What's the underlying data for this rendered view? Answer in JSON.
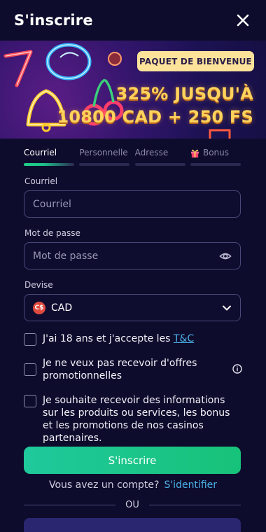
{
  "header": {
    "title": "S'inscrire",
    "close_icon": "close-icon"
  },
  "banner": {
    "badge": "PAQUET DE BIENVENUE",
    "line1": "325% JUSQU'À",
    "line2": "10800 CAD + 250 FS",
    "accent": "#ffd35c"
  },
  "steps": [
    {
      "label": "Courriel",
      "active": true
    },
    {
      "label": "Personnelle",
      "active": false
    },
    {
      "label": "Adresse",
      "active": false
    },
    {
      "label": "Bonus",
      "active": false,
      "icon": "gift-icon"
    }
  ],
  "form": {
    "email": {
      "label": "Courriel",
      "placeholder": "Courriel",
      "value": ""
    },
    "password": {
      "label": "Mot de passe",
      "placeholder": "Mot de passe",
      "value": "",
      "icon": "eye-icon"
    },
    "currency": {
      "label": "Devise",
      "value": "CAD",
      "flag": "C$",
      "icon": "chevron-down-icon"
    },
    "checks": [
      {
        "text": "J'ai 18 ans et j'accepte les",
        "link": "T&C",
        "checked": false
      },
      {
        "text": "Je ne veux pas recevoir d'offres promotionnelles",
        "checked": false,
        "icon": "info-icon"
      },
      {
        "text": "Je souhaite recevoir des informations sur les produits ou services, les bonus et les promotions de nos casinos partenaires.",
        "checked": false
      }
    ],
    "submit_label": "S'inscrire"
  },
  "footer": {
    "have_account": "Vous avez un compte?",
    "login_link": "S'identifier",
    "or_label": "OU"
  },
  "colors": {
    "background": "#0e0c2c",
    "primary_green": "#1ec58a",
    "link": "#4ab0e8"
  }
}
